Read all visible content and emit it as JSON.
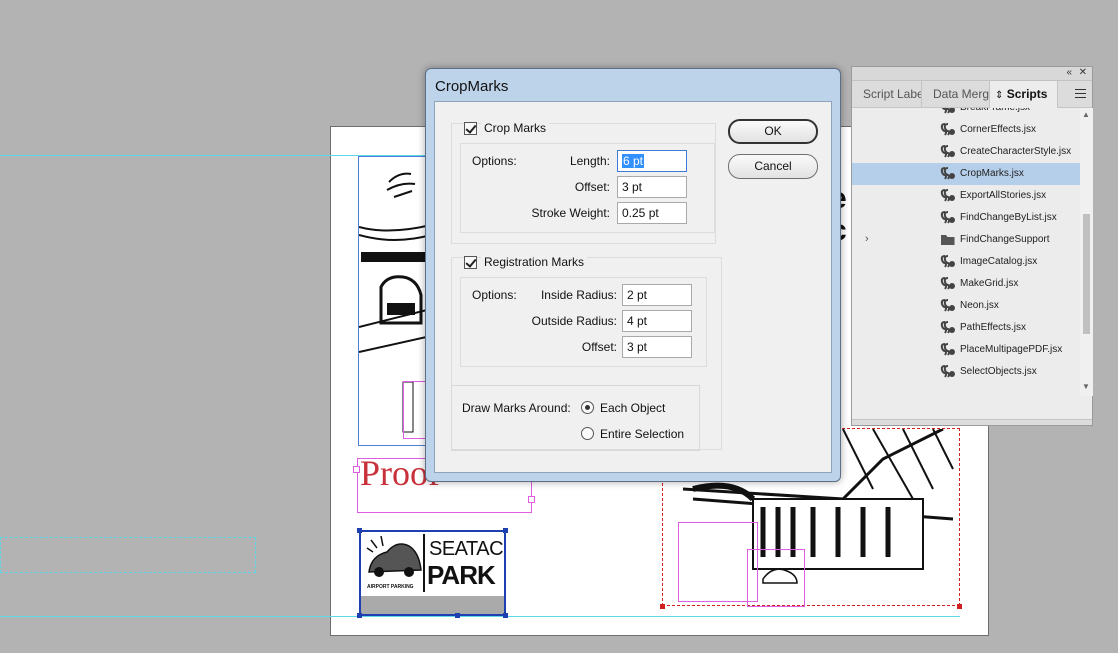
{
  "dialog": {
    "title": "CropMarks",
    "ok_label": "OK",
    "cancel_label": "Cancel",
    "crop_marks": {
      "label": "Crop Marks",
      "checked": true,
      "options_label": "Options:",
      "length_label": "Length:",
      "length_value": "6 pt",
      "offset_label": "Offset:",
      "offset_value": "3 pt",
      "stroke_label": "Stroke Weight:",
      "stroke_value": "0.25 pt"
    },
    "registration_marks": {
      "label": "Registration Marks",
      "checked": true,
      "options_label": "Options:",
      "inside_label": "Inside Radius:",
      "inside_value": "2 pt",
      "outside_label": "Outside Radius:",
      "outside_value": "4 pt",
      "offset_label": "Offset:",
      "offset_value": "3 pt"
    },
    "draw_marks": {
      "label": "Draw Marks Around:",
      "option_each": "Each Object",
      "option_entire": "Entire Selection",
      "selected": "Each Object"
    }
  },
  "scripts_panel": {
    "tabs": [
      "Script Labe",
      "Data Merge",
      "Scripts"
    ],
    "active_tab": "Scripts",
    "items": [
      {
        "name": "BreakFrame.jsx",
        "type": "script"
      },
      {
        "name": "CornerEffects.jsx",
        "type": "script"
      },
      {
        "name": "CreateCharacterStyle.jsx",
        "type": "script"
      },
      {
        "name": "CropMarks.jsx",
        "type": "script",
        "selected": true
      },
      {
        "name": "ExportAllStories.jsx",
        "type": "script"
      },
      {
        "name": "FindChangeByList.jsx",
        "type": "script"
      },
      {
        "name": "FindChangeSupport",
        "type": "folder"
      },
      {
        "name": "ImageCatalog.jsx",
        "type": "script"
      },
      {
        "name": "MakeGrid.jsx",
        "type": "script"
      },
      {
        "name": "Neon.jsx",
        "type": "script"
      },
      {
        "name": "PathEffects.jsx",
        "type": "script"
      },
      {
        "name": "PlaceMultipagePDF.jsx",
        "type": "script"
      },
      {
        "name": "SelectObjects.jsx",
        "type": "script"
      }
    ]
  },
  "document": {
    "proof_text": "Proof",
    "logo": {
      "seatac": "SEATAC",
      "park": "PARK",
      "airport_parking": "AIRPORT PARKING"
    }
  },
  "colors": {
    "guide": "#5fd8e8",
    "selection_blue": "#1d3fb0",
    "frame_magenta": "#e05ce0",
    "proof_red": "#c8303a",
    "list_selected": "#b5cfea"
  }
}
